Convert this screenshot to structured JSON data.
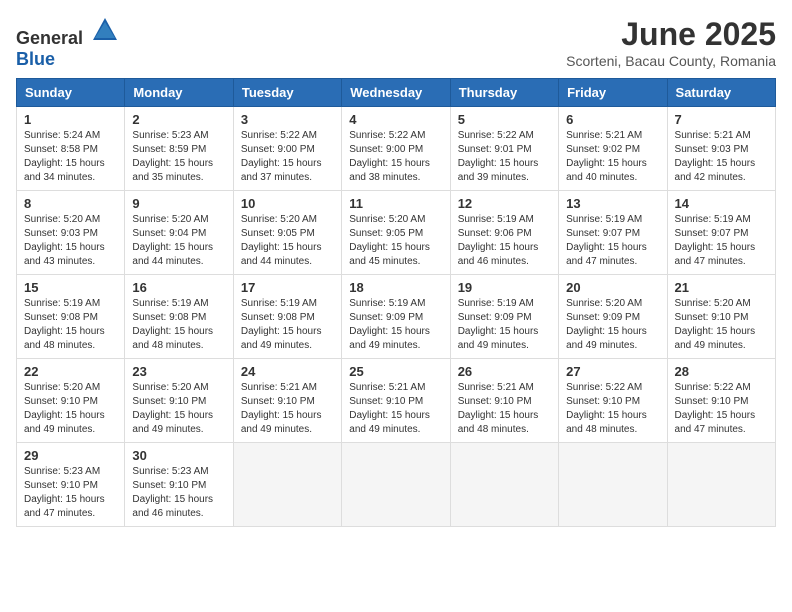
{
  "header": {
    "logo_general": "General",
    "logo_blue": "Blue",
    "month": "June 2025",
    "location": "Scorteni, Bacau County, Romania"
  },
  "weekdays": [
    "Sunday",
    "Monday",
    "Tuesday",
    "Wednesday",
    "Thursday",
    "Friday",
    "Saturday"
  ],
  "weeks": [
    [
      {
        "day": "1",
        "info": "Sunrise: 5:24 AM\nSunset: 8:58 PM\nDaylight: 15 hours\nand 34 minutes."
      },
      {
        "day": "2",
        "info": "Sunrise: 5:23 AM\nSunset: 8:59 PM\nDaylight: 15 hours\nand 35 minutes."
      },
      {
        "day": "3",
        "info": "Sunrise: 5:22 AM\nSunset: 9:00 PM\nDaylight: 15 hours\nand 37 minutes."
      },
      {
        "day": "4",
        "info": "Sunrise: 5:22 AM\nSunset: 9:00 PM\nDaylight: 15 hours\nand 38 minutes."
      },
      {
        "day": "5",
        "info": "Sunrise: 5:22 AM\nSunset: 9:01 PM\nDaylight: 15 hours\nand 39 minutes."
      },
      {
        "day": "6",
        "info": "Sunrise: 5:21 AM\nSunset: 9:02 PM\nDaylight: 15 hours\nand 40 minutes."
      },
      {
        "day": "7",
        "info": "Sunrise: 5:21 AM\nSunset: 9:03 PM\nDaylight: 15 hours\nand 42 minutes."
      }
    ],
    [
      {
        "day": "8",
        "info": "Sunrise: 5:20 AM\nSunset: 9:03 PM\nDaylight: 15 hours\nand 43 minutes."
      },
      {
        "day": "9",
        "info": "Sunrise: 5:20 AM\nSunset: 9:04 PM\nDaylight: 15 hours\nand 44 minutes."
      },
      {
        "day": "10",
        "info": "Sunrise: 5:20 AM\nSunset: 9:05 PM\nDaylight: 15 hours\nand 44 minutes."
      },
      {
        "day": "11",
        "info": "Sunrise: 5:20 AM\nSunset: 9:05 PM\nDaylight: 15 hours\nand 45 minutes."
      },
      {
        "day": "12",
        "info": "Sunrise: 5:19 AM\nSunset: 9:06 PM\nDaylight: 15 hours\nand 46 minutes."
      },
      {
        "day": "13",
        "info": "Sunrise: 5:19 AM\nSunset: 9:07 PM\nDaylight: 15 hours\nand 47 minutes."
      },
      {
        "day": "14",
        "info": "Sunrise: 5:19 AM\nSunset: 9:07 PM\nDaylight: 15 hours\nand 47 minutes."
      }
    ],
    [
      {
        "day": "15",
        "info": "Sunrise: 5:19 AM\nSunset: 9:08 PM\nDaylight: 15 hours\nand 48 minutes."
      },
      {
        "day": "16",
        "info": "Sunrise: 5:19 AM\nSunset: 9:08 PM\nDaylight: 15 hours\nand 48 minutes."
      },
      {
        "day": "17",
        "info": "Sunrise: 5:19 AM\nSunset: 9:08 PM\nDaylight: 15 hours\nand 49 minutes."
      },
      {
        "day": "18",
        "info": "Sunrise: 5:19 AM\nSunset: 9:09 PM\nDaylight: 15 hours\nand 49 minutes."
      },
      {
        "day": "19",
        "info": "Sunrise: 5:19 AM\nSunset: 9:09 PM\nDaylight: 15 hours\nand 49 minutes."
      },
      {
        "day": "20",
        "info": "Sunrise: 5:20 AM\nSunset: 9:09 PM\nDaylight: 15 hours\nand 49 minutes."
      },
      {
        "day": "21",
        "info": "Sunrise: 5:20 AM\nSunset: 9:10 PM\nDaylight: 15 hours\nand 49 minutes."
      }
    ],
    [
      {
        "day": "22",
        "info": "Sunrise: 5:20 AM\nSunset: 9:10 PM\nDaylight: 15 hours\nand 49 minutes."
      },
      {
        "day": "23",
        "info": "Sunrise: 5:20 AM\nSunset: 9:10 PM\nDaylight: 15 hours\nand 49 minutes."
      },
      {
        "day": "24",
        "info": "Sunrise: 5:21 AM\nSunset: 9:10 PM\nDaylight: 15 hours\nand 49 minutes."
      },
      {
        "day": "25",
        "info": "Sunrise: 5:21 AM\nSunset: 9:10 PM\nDaylight: 15 hours\nand 49 minutes."
      },
      {
        "day": "26",
        "info": "Sunrise: 5:21 AM\nSunset: 9:10 PM\nDaylight: 15 hours\nand 48 minutes."
      },
      {
        "day": "27",
        "info": "Sunrise: 5:22 AM\nSunset: 9:10 PM\nDaylight: 15 hours\nand 48 minutes."
      },
      {
        "day": "28",
        "info": "Sunrise: 5:22 AM\nSunset: 9:10 PM\nDaylight: 15 hours\nand 47 minutes."
      }
    ],
    [
      {
        "day": "29",
        "info": "Sunrise: 5:23 AM\nSunset: 9:10 PM\nDaylight: 15 hours\nand 47 minutes."
      },
      {
        "day": "30",
        "info": "Sunrise: 5:23 AM\nSunset: 9:10 PM\nDaylight: 15 hours\nand 46 minutes."
      },
      null,
      null,
      null,
      null,
      null
    ]
  ]
}
